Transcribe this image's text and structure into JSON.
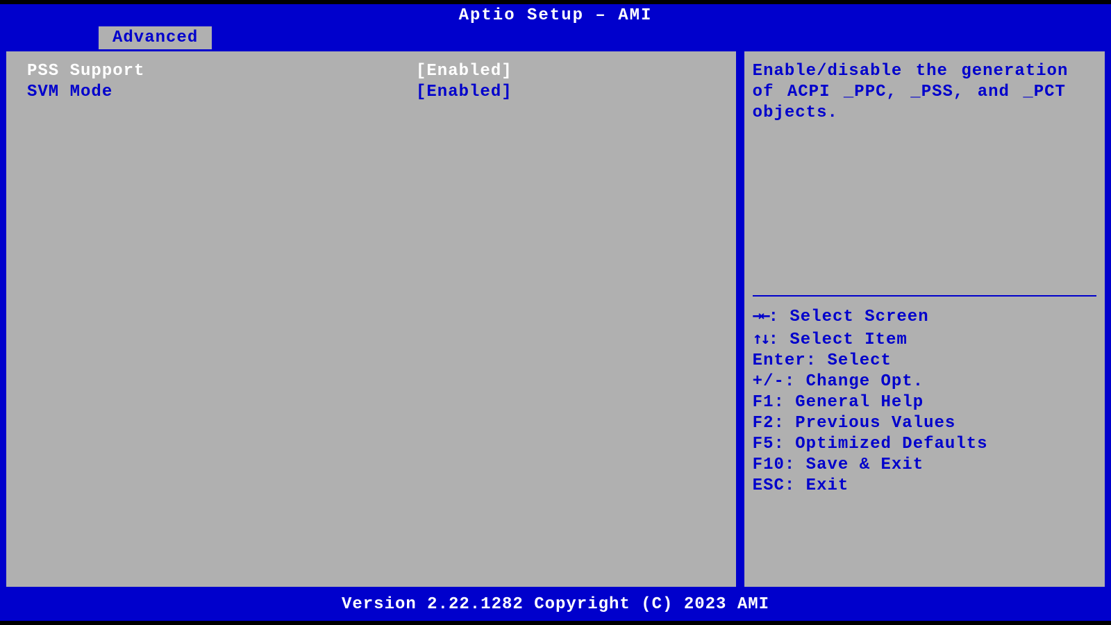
{
  "header": {
    "title": "Aptio Setup – AMI"
  },
  "tabs": [
    {
      "label": "Advanced"
    }
  ],
  "options": [
    {
      "label": "PSS Support",
      "value": "[Enabled]",
      "selected": true
    },
    {
      "label": "SVM Mode",
      "value": "[Enabled]",
      "selected": false
    }
  ],
  "help": {
    "text": "Enable/disable the generation of ACPI _PPC, _PSS, and _PCT objects."
  },
  "keys": {
    "select_screen_icon": "→←",
    "select_screen": ": Select Screen",
    "select_item_icon": "↑↓",
    "select_item": ": Select Item",
    "enter": "Enter: Select",
    "change": "+/-: Change Opt.",
    "f1": "F1: General Help",
    "f2": "F2: Previous Values",
    "f5": "F5: Optimized Defaults",
    "f10": "F10: Save & Exit",
    "esc": "ESC: Exit"
  },
  "footer": {
    "text": "Version 2.22.1282 Copyright (C) 2023 AMI"
  }
}
